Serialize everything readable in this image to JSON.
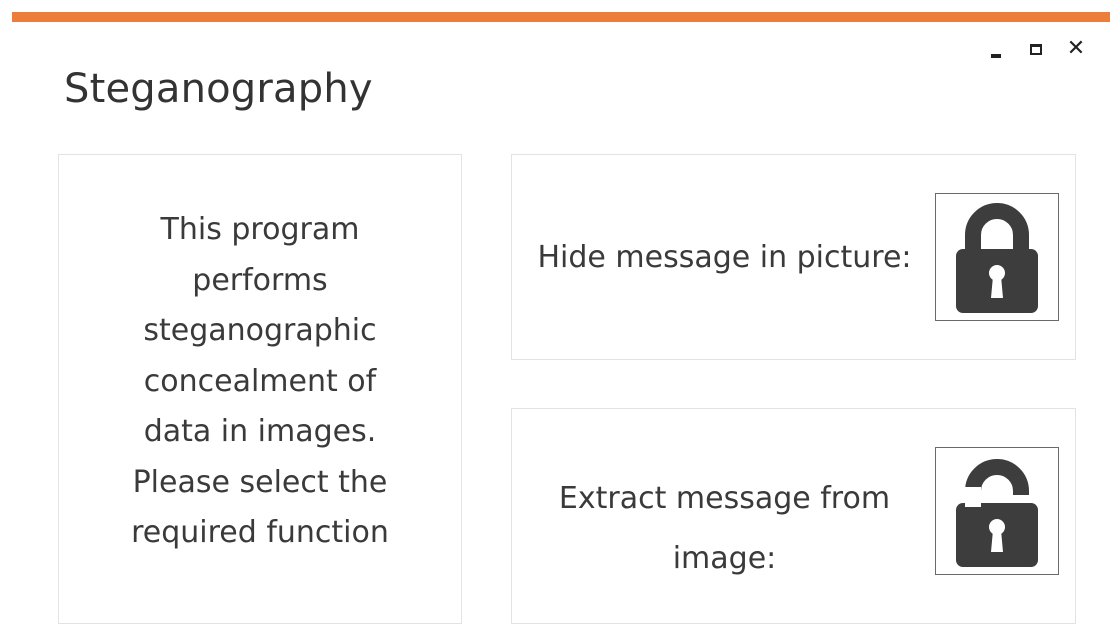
{
  "window": {
    "title": "Steganography",
    "accent_color": "#ED7D3A",
    "controls": {
      "minimize_icon": "minimize-icon",
      "maximize_icon": "maximize-icon",
      "close_label": "✕"
    }
  },
  "info_panel": {
    "text_lines": [
      "This program",
      "performs",
      "steganographic",
      "concealment of",
      "data in images.",
      "Please select the",
      "required function"
    ]
  },
  "actions": {
    "hide": {
      "label": "Hide message in picture:",
      "icon": "lock-closed-icon"
    },
    "extract": {
      "label_lines": [
        "Extract message from",
        "image:"
      ],
      "icon": "lock-open-icon"
    }
  }
}
